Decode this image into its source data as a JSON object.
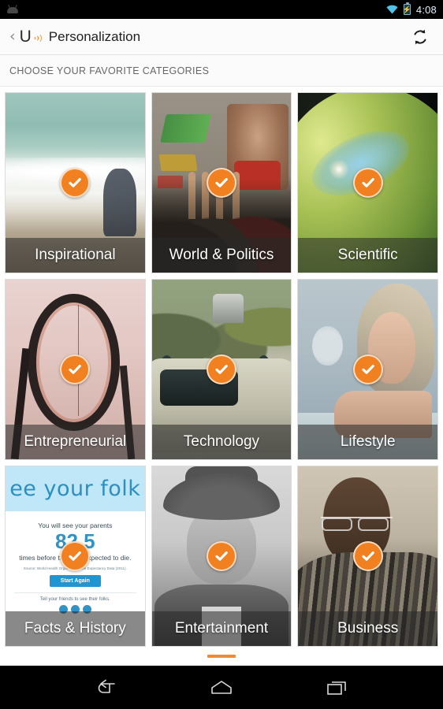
{
  "status_bar": {
    "notification_icon": "android-robot-icon",
    "wifi_icon": "wifi-icon",
    "battery_icon": "battery-charging-icon",
    "time": "4:08"
  },
  "action_bar": {
    "back_label": "‹",
    "logo_letter": "U",
    "logo_icon": "umano-sound-waves-icon",
    "title": "Personalization",
    "refresh_icon": "refresh-icon"
  },
  "subheader": {
    "text": "CHOOSE YOUR FAVORITE CATEGORIES"
  },
  "colors": {
    "accent_orange": "#F08020",
    "indicator_orange": "#EF8B33",
    "status_bar_bg": "#000000",
    "action_bar_bg": "#FBFBFB"
  },
  "grid": {
    "tiles": [
      {
        "label": "Inspirational",
        "selected": true,
        "art": "beach-ocean-photo"
      },
      {
        "label": "World & Politics",
        "selected": true,
        "art": "protest-crowd-graffiti-photo"
      },
      {
        "label": "Scientific",
        "selected": true,
        "art": "planet-space-photo"
      },
      {
        "label": "Entrepreneurial",
        "selected": true,
        "art": "roller-coaster-photo"
      },
      {
        "label": "Technology",
        "selected": true,
        "art": "self-driving-car-photo"
      },
      {
        "label": "Lifestyle",
        "selected": true,
        "art": "woman-in-bed-photo"
      },
      {
        "label": "Facts & History",
        "selected": true,
        "art": "see-your-folks-webpage-screenshot"
      },
      {
        "label": "Entertainment",
        "selected": true,
        "art": "man-with-fedora-portrait-photo"
      },
      {
        "label": "Business",
        "selected": true,
        "art": "man-with-glasses-photo"
      }
    ],
    "check_icon": "check-circle-icon"
  },
  "facts_tile_art": {
    "hero_text": "ee your folk",
    "line1": "You will see your parents",
    "big_number": "82.5",
    "line2": "times before they are expected to die.",
    "source": "Source: World Health Organisation Life Expectancy Data (2011).",
    "cta": "Start Again",
    "tell": "Tell your friends to see their folks."
  },
  "page_indicator": {
    "current_page": 1,
    "total_pages": 1
  },
  "nav_bar": {
    "back_icon": "back-arrow-icon",
    "home_icon": "home-icon",
    "recents_icon": "recent-apps-icon"
  }
}
